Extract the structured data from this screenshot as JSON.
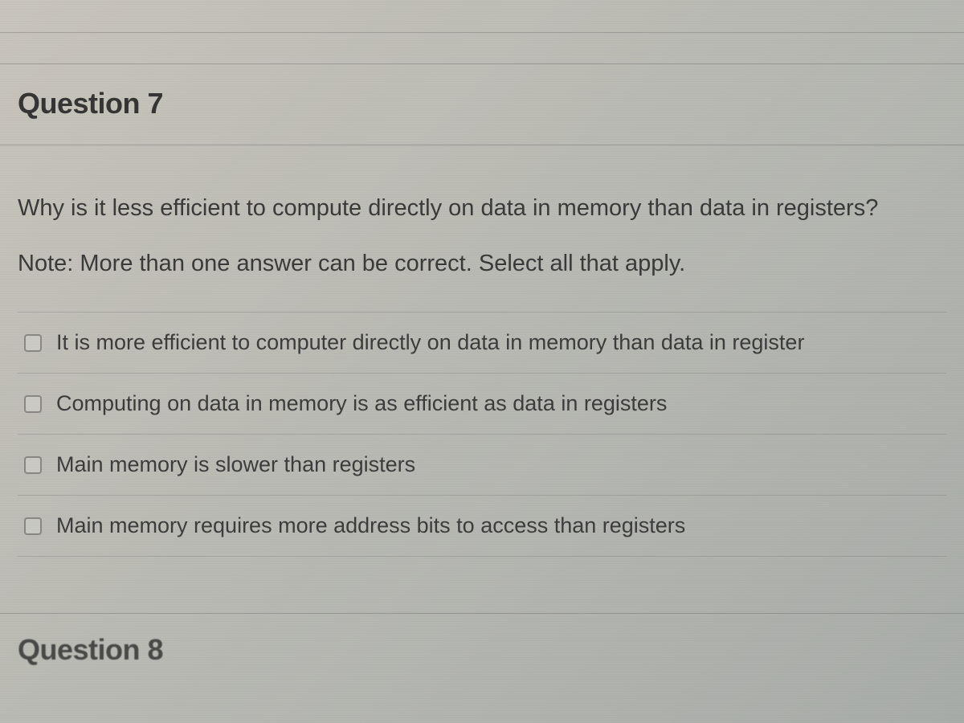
{
  "question": {
    "title": "Question 7",
    "prompt": "Why is it less efficient to compute directly on data in memory than data in registers?",
    "note": "Note: More than one answer can be correct. Select all that apply.",
    "options": [
      {
        "label": "It is more efficient to computer directly on data in memory than data in register"
      },
      {
        "label": "Computing on data in memory is as efficient as data in registers"
      },
      {
        "label": "Main memory is slower than registers"
      },
      {
        "label": "Main memory requires more address bits to access than registers"
      }
    ]
  },
  "next_question": {
    "title": "Question 8"
  }
}
